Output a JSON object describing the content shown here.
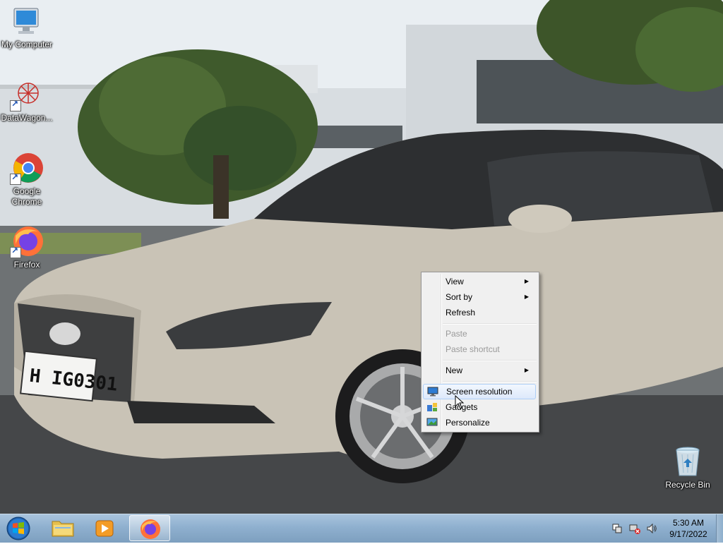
{
  "desktop": {
    "icons": [
      {
        "label": "My Computer",
        "icon": "computer-icon"
      },
      {
        "label": "DataWagon...",
        "icon": "datawagon-icon"
      },
      {
        "label": "Google Chrome",
        "icon": "chrome-icon"
      },
      {
        "label": "Firefox",
        "icon": "firefox-icon"
      },
      {
        "label": "Recycle Bin",
        "icon": "recycle-bin-icon"
      }
    ],
    "license_plate": "H IG0301"
  },
  "context_menu": {
    "items": [
      {
        "label": "View",
        "submenu": true
      },
      {
        "label": "Sort by",
        "submenu": true
      },
      {
        "label": "Refresh"
      },
      {
        "label": "Paste",
        "disabled": true
      },
      {
        "label": "Paste shortcut",
        "disabled": true
      },
      {
        "label": "New",
        "submenu": true
      },
      {
        "label": "Screen resolution",
        "icon": "display-icon",
        "highlighted": true
      },
      {
        "label": "Gadgets",
        "icon": "gadgets-icon"
      },
      {
        "label": "Personalize",
        "icon": "personalize-icon"
      }
    ],
    "submenu_arrow": "▶"
  },
  "taskbar": {
    "pinned": [
      {
        "name": "Windows Explorer",
        "icon": "folder-icon"
      },
      {
        "name": "Windows Media Player",
        "icon": "media-player-icon"
      },
      {
        "name": "Firefox",
        "icon": "firefox-icon",
        "active": true
      }
    ],
    "clock": {
      "time": "5:30 AM",
      "date": "9/17/2022"
    }
  },
  "colors": {
    "taskbar": "#8fb0cf",
    "menu_bg": "#f0f0f0",
    "menu_highlight": "#dde9fb"
  }
}
